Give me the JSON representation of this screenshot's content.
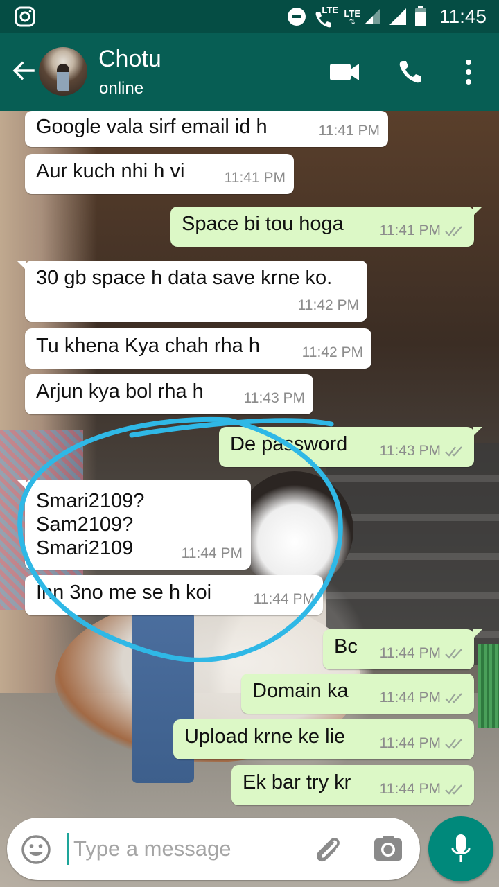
{
  "status_bar": {
    "time": "11:45",
    "lte1": "LTE",
    "lte2": "LTE",
    "icons": [
      "instagram-icon",
      "do-not-disturb-icon",
      "wifi-call-icon",
      "signal-icon",
      "battery-icon"
    ]
  },
  "header": {
    "contact_name": "Chotu",
    "contact_status": "online",
    "icons": [
      "back-arrow-icon",
      "video-call-icon",
      "phone-icon",
      "more-options-icon"
    ],
    "background_color": "#075e54"
  },
  "messages": [
    {
      "direction": "in",
      "text": "Google vala sirf email id h",
      "time": "11:41 PM"
    },
    {
      "direction": "in",
      "text": "Aur kuch nhi h vi",
      "time": "11:41 PM"
    },
    {
      "direction": "out",
      "text": "Space bi tou hoga",
      "time": "11:41 PM",
      "status": "read"
    },
    {
      "direction": "in",
      "text": "30 gb space h data save krne ko.",
      "time": "11:42 PM"
    },
    {
      "direction": "in",
      "text": "Tu khena Kya chah rha h",
      "time": "11:42 PM"
    },
    {
      "direction": "in",
      "text": "Arjun kya bol rha h",
      "time": "11:43 PM"
    },
    {
      "direction": "out",
      "text": "De password",
      "time": "11:43 PM",
      "status": "read"
    },
    {
      "direction": "in",
      "text": "Smari2109?\nSam2109?\nSmari2109",
      "time": "11:44 PM"
    },
    {
      "direction": "in",
      "text": "Inn 3no me se h koi",
      "time": "11:44 PM"
    },
    {
      "direction": "out",
      "text": "Bc",
      "time": "11:44 PM",
      "status": "read"
    },
    {
      "direction": "out",
      "text": "Domain ka",
      "time": "11:44 PM",
      "status": "read"
    },
    {
      "direction": "out",
      "text": "Upload krne ke lie",
      "time": "11:44 PM",
      "status": "read"
    },
    {
      "direction": "out",
      "text": "Ek bar try kr",
      "time": "11:44 PM",
      "status": "read"
    }
  ],
  "composer": {
    "placeholder": "Type a message",
    "value": ""
  },
  "colors": {
    "incoming_bubble": "#ffffff",
    "outgoing_bubble": "#dcf8c6",
    "read_ticks": "#9aa59a",
    "annotation_stroke": "#2fb8e6",
    "mic_button": "#00897b"
  }
}
